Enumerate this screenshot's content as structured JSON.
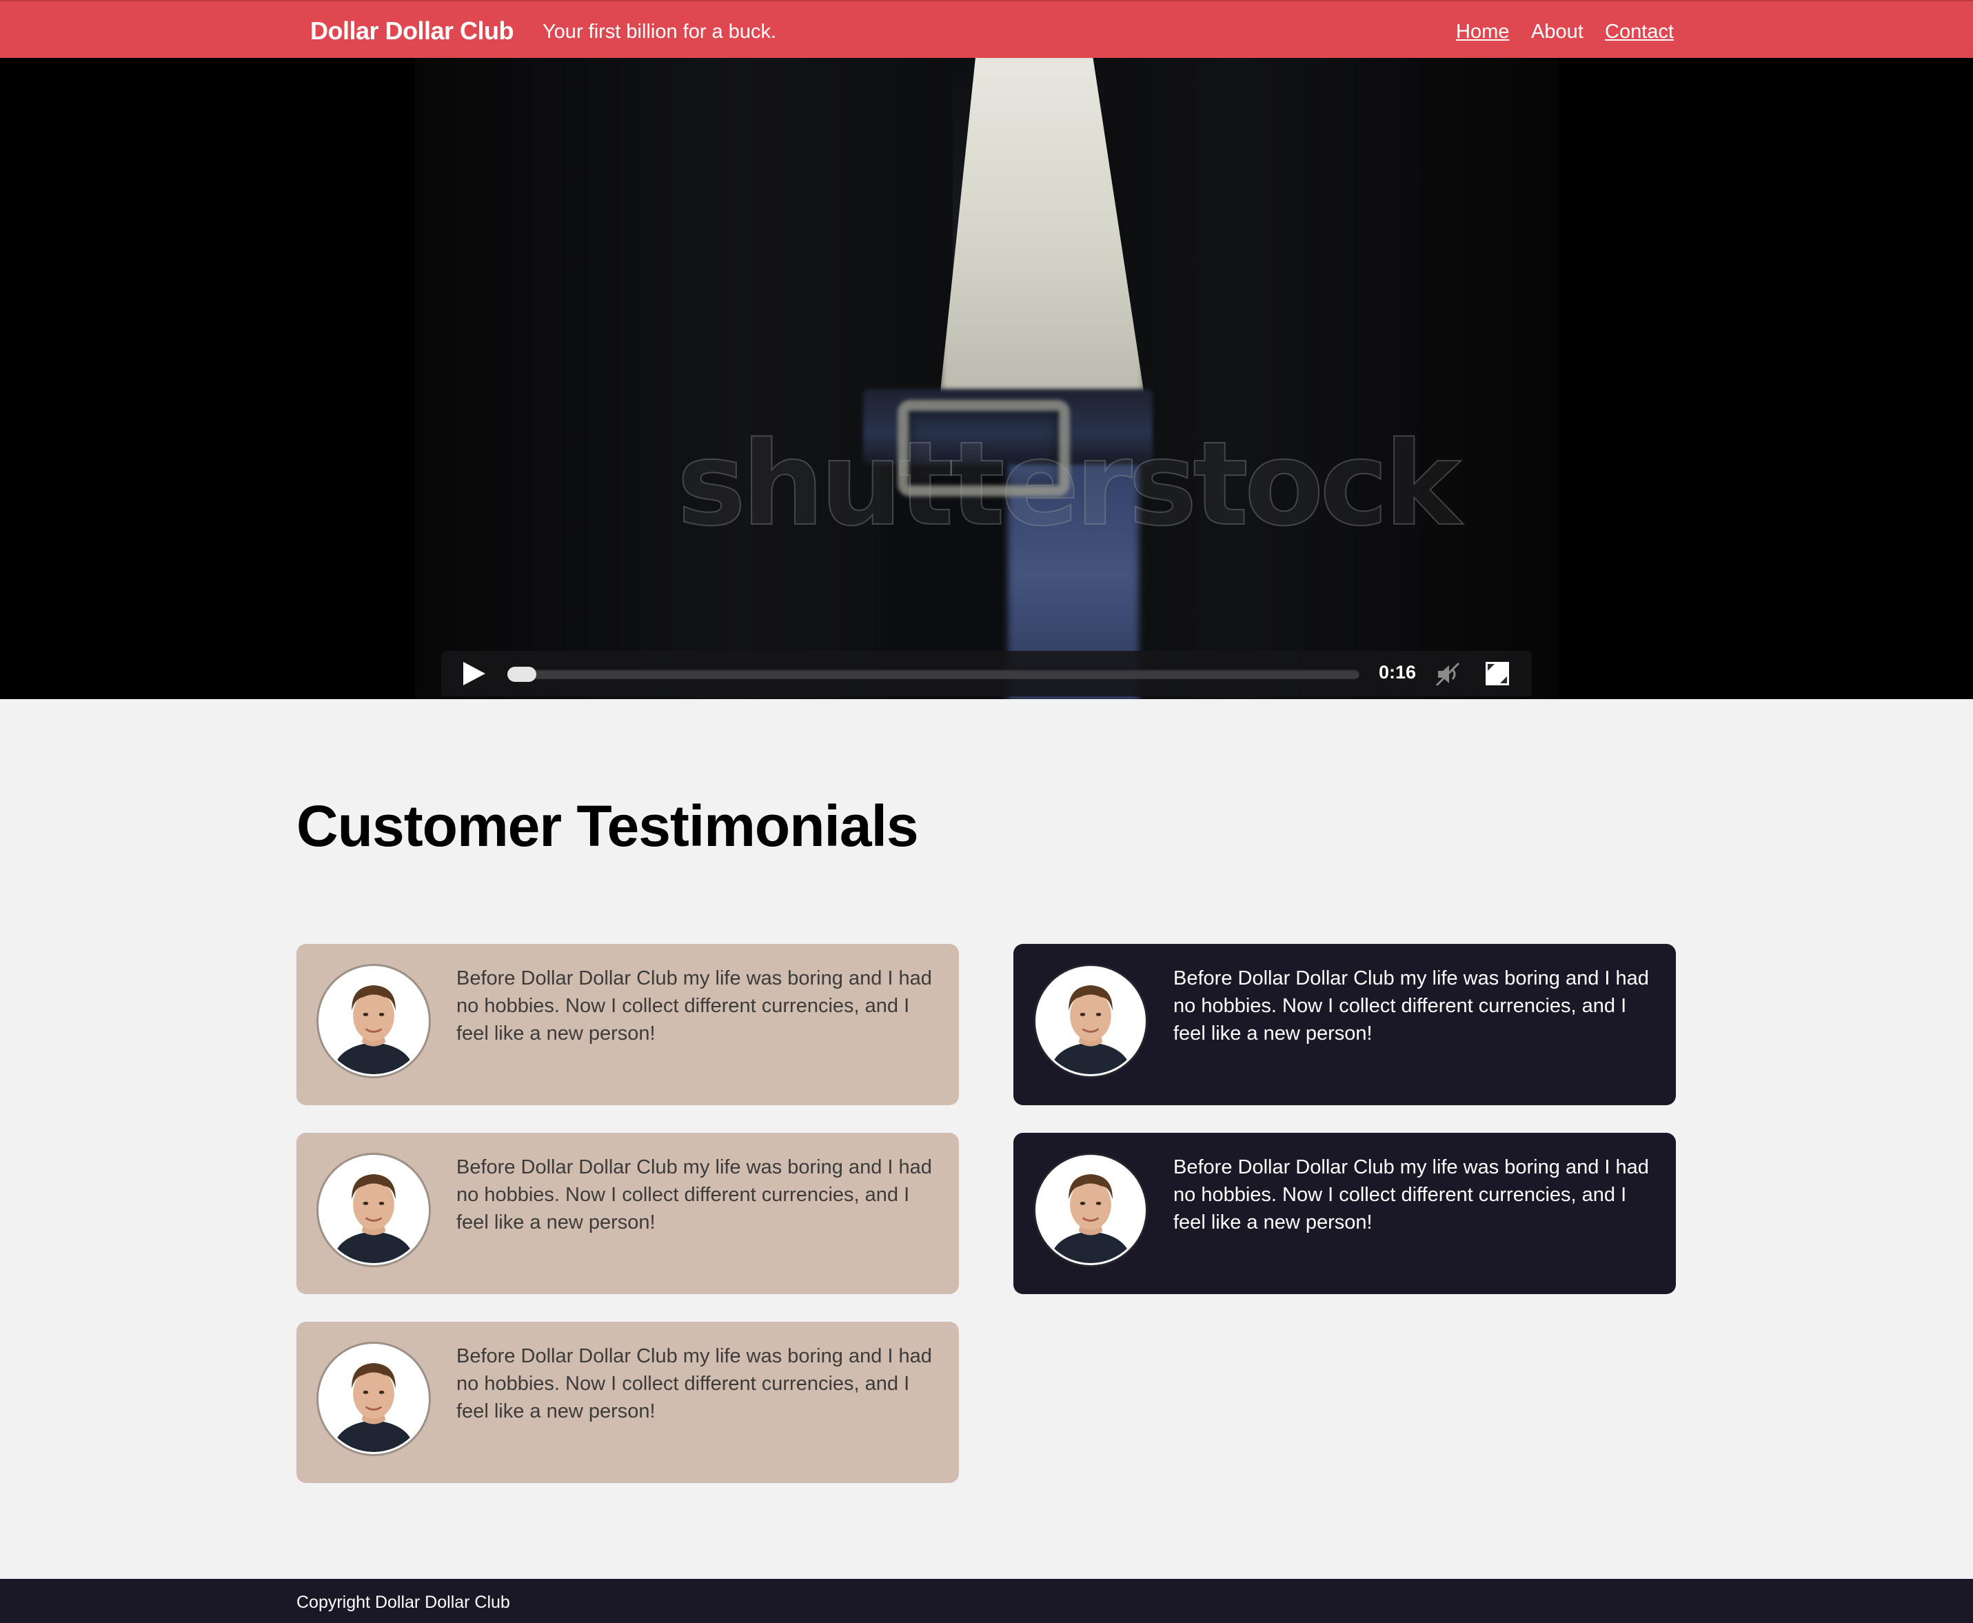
{
  "header": {
    "brand": "Dollar Dollar Club",
    "tagline": "Your first billion for a buck.",
    "nav": {
      "home": "Home",
      "about": "About",
      "contact": "Contact"
    },
    "color": "#e04851"
  },
  "video": {
    "watermark": "shutterstock",
    "time": "0:16",
    "progress": 0.02,
    "icons": [
      "play-icon",
      "mute-icon",
      "fullscreen-icon"
    ]
  },
  "testimonials": {
    "title": "Customer Testimonials",
    "cards": [
      {
        "theme": "light",
        "text": "Before Dollar Dollar Club my life was boring and I had no hobbies. Now I collect different currencies, and I feel like a new person!"
      },
      {
        "theme": "dark",
        "text": "Before Dollar Dollar Club my life was boring and I had no hobbies. Now I collect different currencies, and I feel like a new person!"
      },
      {
        "theme": "light",
        "text": "Before Dollar Dollar Club my life was boring and I had no hobbies. Now I collect different currencies, and I feel like a new person!"
      },
      {
        "theme": "dark",
        "text": "Before Dollar Dollar Club my life was boring and I had no hobbies. Now I collect different currencies, and I feel like a new person!"
      },
      {
        "theme": "light",
        "text": "Before Dollar Dollar Club my life was boring and I had no hobbies. Now I collect different currencies, and I feel like a new person!"
      }
    ],
    "colors": {
      "light": "#d0bdb0",
      "dark": "#1a1726"
    }
  },
  "footer": {
    "copyright": "Copyright Dollar Dollar Club"
  }
}
